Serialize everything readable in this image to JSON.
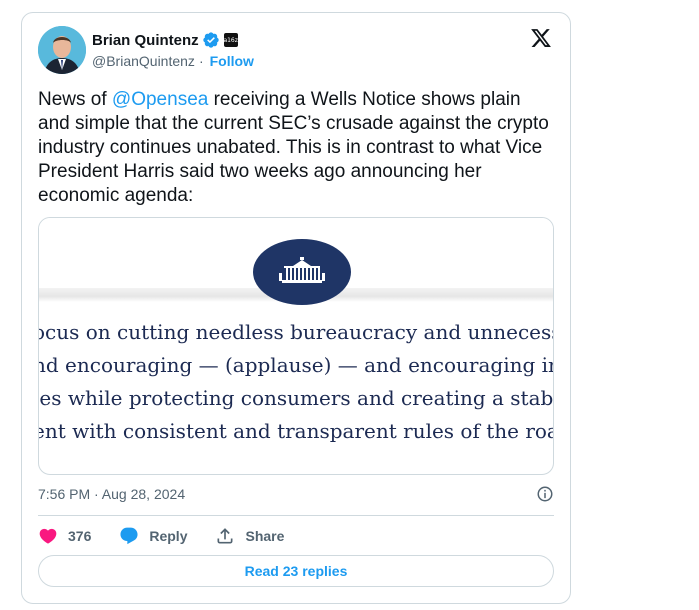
{
  "author": {
    "name": "Brian Quintenz",
    "handle": "@BrianQuintenz",
    "separator": "·",
    "follow_label": "Follow",
    "affiliate_badge_text": "a16z"
  },
  "tweet": {
    "text_before": "News of ",
    "mention": "@Opensea",
    "text_after": " receiving a Wells Notice shows plain and simple that the current SEC’s crusade against the crypto industry continues unabated. This is in contrast to what Vice President Harris said two weeks ago announcing her economic agenda:"
  },
  "media": {
    "quote_lines": [
      "ocus on cutting needless bureaucracy and unnecessary reg",
      "nd encouraging — (applause) —  and encouraging innovat",
      "ies while protecting consumers and creating a stable busi",
      "ent with consistent and transparent rules of the road."
    ]
  },
  "timestamp": "7:56 PM · Aug 28, 2024",
  "actions": {
    "likes": "376",
    "reply_label": "Reply",
    "share_label": "Share"
  },
  "read_replies_label": "Read 23 replies",
  "colors": {
    "accent": "#1d9bf0",
    "like": "#f91880",
    "text": "#0f1419",
    "muted": "#536471"
  }
}
